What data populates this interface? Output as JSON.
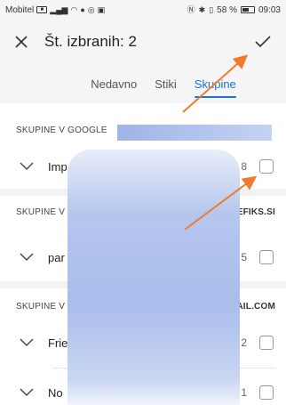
{
  "status_bar": {
    "carrier": "Mobitel",
    "battery": "58 %",
    "battery_fraction": 0.58,
    "time": "09:03"
  },
  "header": {
    "title": "Št. izbranih: 2"
  },
  "tabs": [
    {
      "label": "Nedavno",
      "active": false
    },
    {
      "label": "Stiki",
      "active": false
    },
    {
      "label": "Skupine",
      "active": true
    }
  ],
  "sections": [
    {
      "title": "SKUPINE V GOOGLE",
      "account_suffix": "",
      "rows": [
        {
          "label": "Imp",
          "count": "8"
        }
      ]
    },
    {
      "title": "SKUPINE V",
      "account_suffix": "EFIKS.SI",
      "rows": [
        {
          "label": "par",
          "count": "5"
        }
      ]
    },
    {
      "title": "SKUPINE V",
      "account_suffix": "AIL.COM",
      "rows": [
        {
          "label": "Frie",
          "count": "2"
        },
        {
          "label": "No",
          "count": "1"
        }
      ]
    }
  ],
  "colors": {
    "accent": "#1a73d6",
    "annotation_arrow": "#f07b2c"
  },
  "icons": {
    "close": "close-icon",
    "confirm": "check-icon",
    "expand": "chevron-down-icon"
  }
}
